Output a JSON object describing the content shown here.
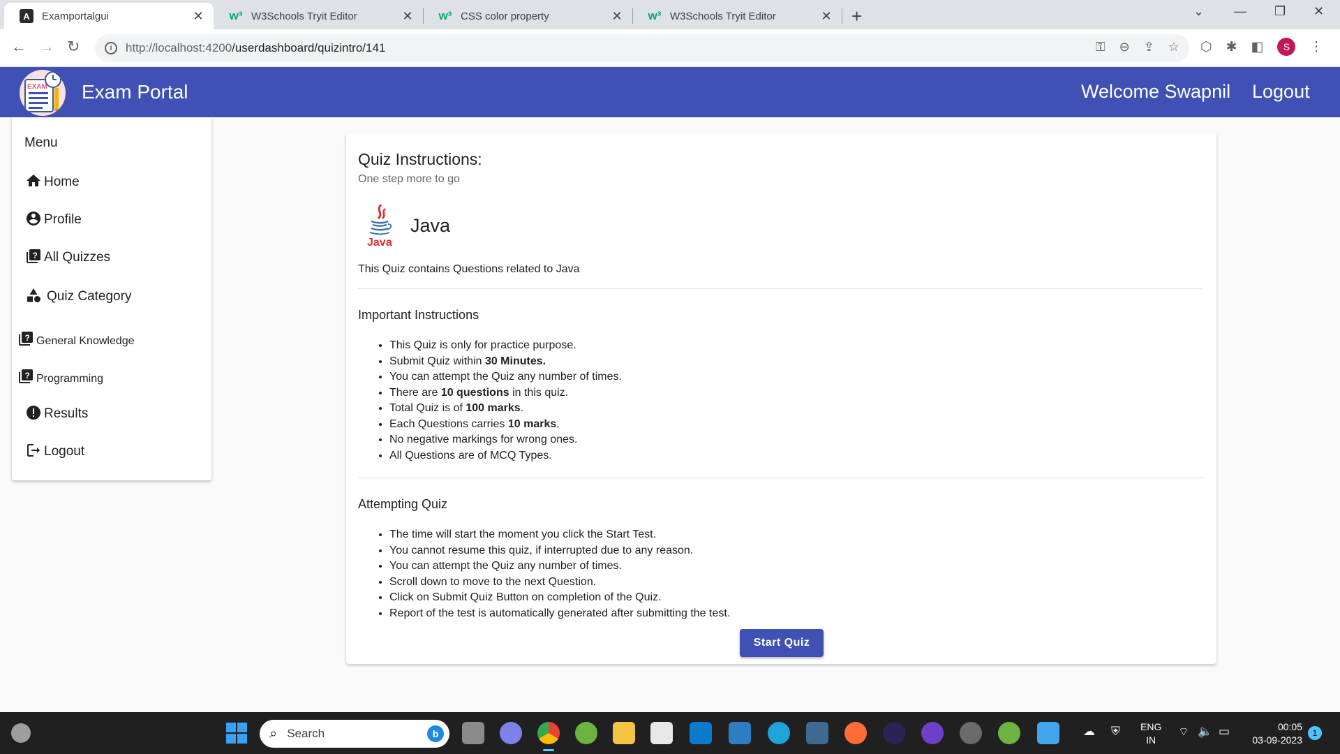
{
  "browser": {
    "tabs": [
      {
        "title": "Examportalgui",
        "favicon": "angular-icon"
      },
      {
        "title": "W3Schools Tryit Editor",
        "favicon": "w3schools-icon"
      },
      {
        "title": "CSS color property",
        "favicon": "w3schools-icon"
      },
      {
        "title": "W3Schools Tryit Editor",
        "favicon": "w3schools-icon"
      }
    ],
    "url_host": "http://localhost:4200",
    "url_path": "/userdashboard/quizintro/141",
    "profile_initial": "S"
  },
  "header": {
    "title": "Exam Portal",
    "welcome": "Welcome Swapnil",
    "logout": "Logout",
    "logo_text": "EXAM"
  },
  "sidebar": {
    "menu_title": "Menu",
    "items": [
      {
        "label": "Home",
        "icon": "home-icon"
      },
      {
        "label": "Profile",
        "icon": "account-circle-icon"
      },
      {
        "label": "All Quizzes",
        "icon": "quiz-icon"
      },
      {
        "label": "Quiz Category",
        "icon": "category-icon"
      },
      {
        "label": "General Knowledge",
        "icon": "quiz-icon"
      },
      {
        "label": "Programming",
        "icon": "quiz-icon"
      },
      {
        "label": "Results",
        "icon": "error-icon"
      },
      {
        "label": "Logout",
        "icon": "logout-icon"
      }
    ]
  },
  "quiz": {
    "heading": "Quiz Instructions:",
    "subheading": "One step more to go",
    "logo_caption": "Java",
    "category": "Java",
    "description": "This Quiz contains Questions related to Java",
    "important_title": "Important Instructions",
    "important": [
      {
        "before": "This Quiz is only for practice purpose.",
        "bold": "",
        "after": ""
      },
      {
        "before": "Submit Quiz within ",
        "bold": "30 Minutes.",
        "after": ""
      },
      {
        "before": "You can attempt the Quiz any number of times.",
        "bold": "",
        "after": ""
      },
      {
        "before": "There are ",
        "bold": "10 questions",
        "after": " in this quiz."
      },
      {
        "before": "Total Quiz is of ",
        "bold": "100 marks",
        "after": "."
      },
      {
        "before": "Each Questions carries ",
        "bold": "10 marks",
        "after": "."
      },
      {
        "before": "No negative markings for wrong ones.",
        "bold": "",
        "after": ""
      },
      {
        "before": "All Questions are of MCQ Types.",
        "bold": "",
        "after": ""
      }
    ],
    "attempting_title": "Attempting Quiz",
    "attempting": [
      "The time will start the moment you click the Start Test.",
      "You cannot resume this quiz, if interrupted due to any reason.",
      "You can attempt the Quiz any number of times.",
      "Scroll down to move to the next Question.",
      "Click on Submit Quiz Button on completion of the Quiz.",
      "Report of the test is automatically generated after submitting the test."
    ],
    "start_button": "Start Quiz"
  },
  "taskbar": {
    "search_placeholder": "Search",
    "lang_line1": "ENG",
    "lang_line2": "IN",
    "time": "00:05",
    "date": "03-09-2023",
    "notification_count": "1"
  },
  "colors": {
    "primary": "#3f51b5",
    "accent": "#c2185b",
    "java_red": "#e32c2e",
    "java_blue": "#3a75b0"
  }
}
